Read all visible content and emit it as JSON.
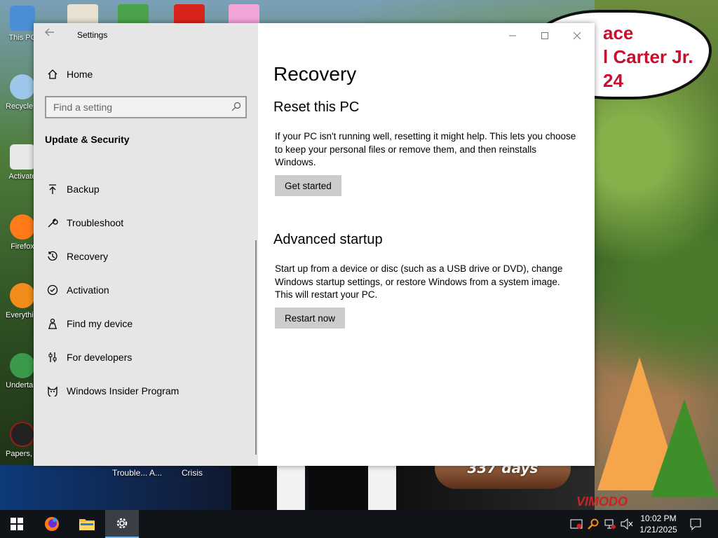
{
  "window": {
    "title": "Settings",
    "back_icon": "back-arrow-icon",
    "controls": {
      "minimize": "minimize-icon",
      "maximize": "maximize-icon",
      "close": "close-icon"
    }
  },
  "nav": {
    "home_label": "Home",
    "search_placeholder": "Find a setting",
    "section_heading": "Update & Security",
    "items": [
      {
        "label": "Backup",
        "icon": "backup-arrow-icon"
      },
      {
        "label": "Troubleshoot",
        "icon": "wrench-icon"
      },
      {
        "label": "Recovery",
        "icon": "recovery-history-icon",
        "selected": true
      },
      {
        "label": "Activation",
        "icon": "check-circle-icon"
      },
      {
        "label": "Find my device",
        "icon": "person-pin-icon"
      },
      {
        "label": "For developers",
        "icon": "developer-sliders-icon"
      },
      {
        "label": "Windows Insider Program",
        "icon": "insider-cat-icon"
      }
    ]
  },
  "content": {
    "page_title": "Recovery",
    "reset": {
      "heading": "Reset this PC",
      "description": "If your PC isn't running well, resetting it might help. This lets you choose to keep your personal files or remove them, and then reinstalls Windows.",
      "button": "Get started"
    },
    "advanced": {
      "heading": "Advanced startup",
      "description": "Start up from a device or disc (such as a USB drive or DVD), change Windows startup settings, or restore Windows from a system image. This will restart your PC.",
      "button": "Restart now"
    }
  },
  "desktop": {
    "icons": [
      {
        "label": "This PC"
      },
      {
        "label": "Recycle Bin"
      },
      {
        "label": "Activate"
      },
      {
        "label": "Firefox"
      },
      {
        "label": "Everything"
      },
      {
        "label": "Undertale"
      },
      {
        "label": "Papers, Please"
      }
    ],
    "partial_labels": [
      "Trouble... A...",
      "Crisis"
    ],
    "speech_bubble": "ace\nl Carter Jr.\n24",
    "snow_globe_text": "337 days",
    "wallpaper_text": "VIMODO"
  },
  "taskbar": {
    "start_icon": "windows-start-icon",
    "pinned": [
      {
        "name": "firefox",
        "icon": "firefox-icon"
      },
      {
        "name": "file-explorer",
        "icon": "folder-icon"
      },
      {
        "name": "settings",
        "icon": "gear-icon",
        "active": true
      }
    ],
    "tray": [
      "security-icon",
      "search-app-icon",
      "network-icon",
      "volume-muted-icon"
    ],
    "time": "10:02 PM",
    "date": "1/21/2025",
    "notification_icon": "action-center-icon"
  }
}
